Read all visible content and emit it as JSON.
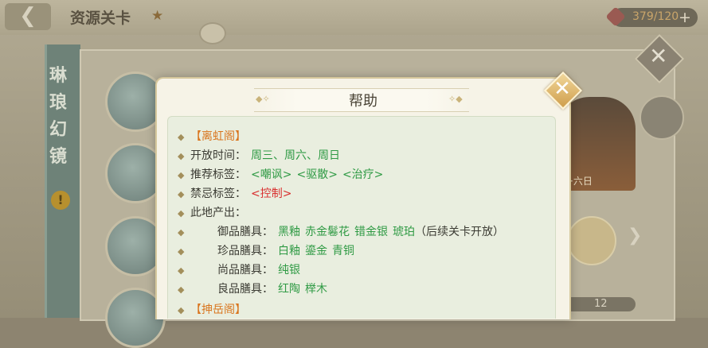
{
  "background": {
    "title": "资源关卡",
    "stamina": "379/120",
    "side_title_chars": [
      "琳",
      "琅",
      "幻",
      "镜"
    ],
    "art_label": "·六日",
    "count": "12",
    "icons": {
      "back": "back-arrow-icon",
      "star": "star-icon",
      "close": "close-icon",
      "plus": "plus-icon"
    }
  },
  "dialog": {
    "title": "帮助",
    "close_icon": "close-icon",
    "sections": [
      {
        "heading": "【离虹阁】"
      },
      {
        "heading": "【抻岳阁】"
      }
    ],
    "lines": {
      "open_time_label": "开放时间：",
      "open_time_value": "周三、周六、周日",
      "recommend_label": "推荐标签：",
      "recommend_values": [
        "<嘲讽>",
        "<驱散>",
        "<治疗>"
      ],
      "forbid_label": "禁忌标签：",
      "forbid_value": "<控制>",
      "produce_label": "此地产出：",
      "rows": [
        {
          "label": "御品膳具：",
          "items": [
            "黑釉",
            "赤金鬈花",
            "错金银",
            "琥珀"
          ],
          "note": "（后续关卡开放）"
        },
        {
          "label": "珍品膳具：",
          "items": [
            "白釉",
            "鎏金",
            "青铜"
          ]
        },
        {
          "label": "尚品膳具：",
          "items": [
            "纯银"
          ]
        },
        {
          "label": "良品膳具：",
          "items": [
            "红陶",
            "榉木"
          ]
        }
      ]
    },
    "colors": {
      "heading": "#d9751e",
      "value": "#2f9a44",
      "forbid": "#d92f2f"
    }
  }
}
